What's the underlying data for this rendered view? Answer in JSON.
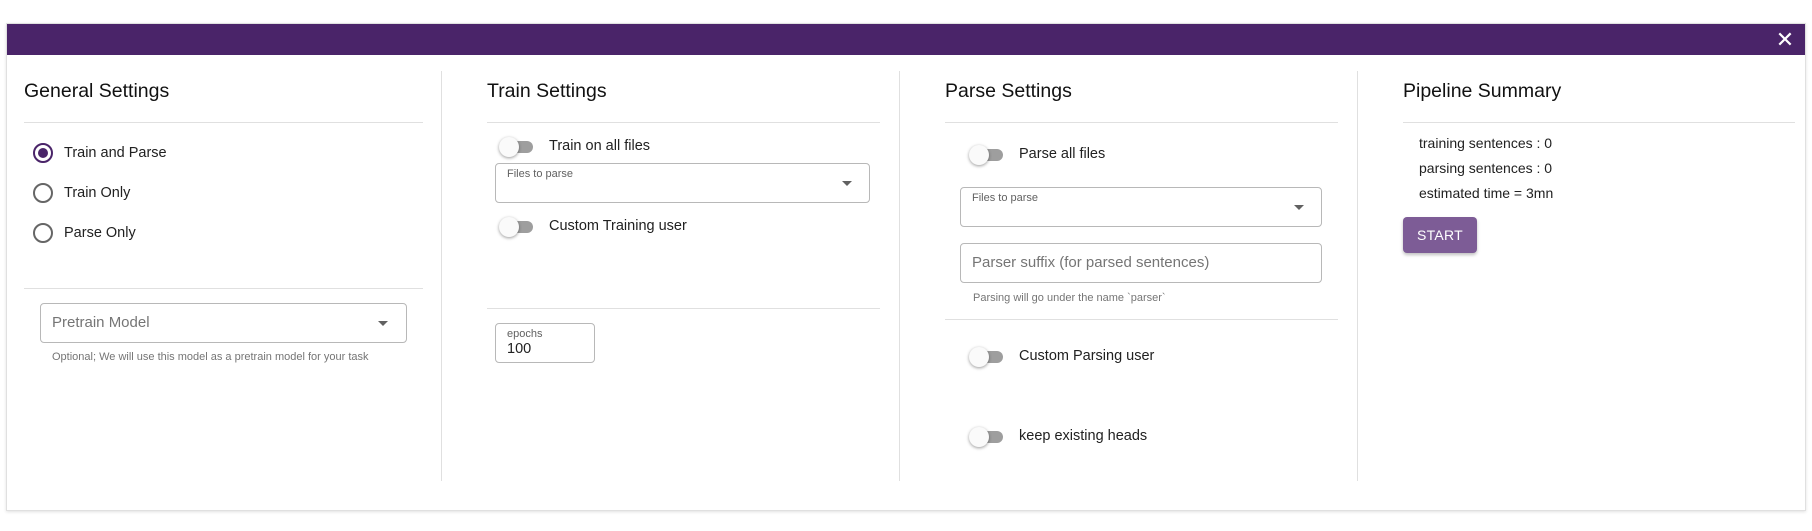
{
  "dialog": {
    "close_label": "✕"
  },
  "general": {
    "title": "General Settings",
    "modes": [
      {
        "label": "Train and Parse",
        "checked": true
      },
      {
        "label": "Train Only",
        "checked": false
      },
      {
        "label": "Parse Only",
        "checked": false
      }
    ],
    "pretrain_placeholder": "Pretrain Model",
    "pretrain_helper": "Optional; We will use this model as a pretrain model for your task"
  },
  "train": {
    "title": "Train Settings",
    "train_all_label": "Train on all files",
    "files_label": "Files to parse",
    "custom_user_label": "Custom Training user",
    "epochs_label": "epochs",
    "epochs_value": "100"
  },
  "parse": {
    "title": "Parse Settings",
    "parse_all_label": "Parse all files",
    "files_label": "Files to parse",
    "suffix_placeholder": "Parser suffix (for parsed sentences)",
    "suffix_helper": "Parsing will go under the name `parser`",
    "custom_user_label": "Custom Parsing user",
    "keep_heads_label": "keep existing heads"
  },
  "summary": {
    "title": "Pipeline Summary",
    "training_sentences": "training sentences : 0",
    "parsing_sentences": "parsing sentences : 0",
    "estimated_time": "estimated time = 3mn",
    "start_label": "START"
  }
}
